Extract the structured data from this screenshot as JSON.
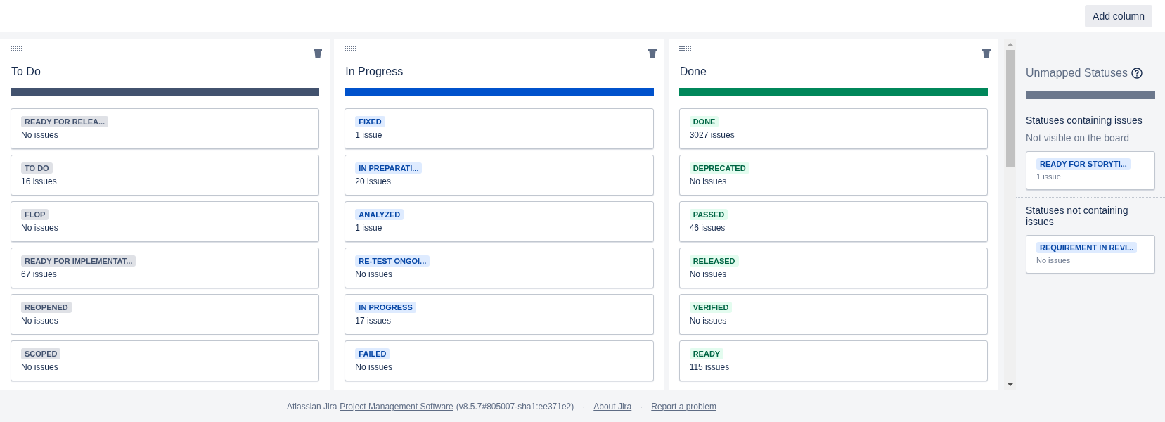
{
  "toolbar": {
    "add_column_button": "Add column"
  },
  "columns": [
    {
      "title": "To Do",
      "color": "#42526e",
      "kind": "todo",
      "statuses": [
        {
          "name": "READY FOR RELEA...",
          "count": "No issues"
        },
        {
          "name": "TO DO",
          "count": "16 issues"
        },
        {
          "name": "FLOP",
          "count": "No issues"
        },
        {
          "name": "READY FOR IMPLEMENTAT...",
          "count": "67 issues"
        },
        {
          "name": "REOPENED",
          "count": "No issues"
        },
        {
          "name": "SCOPED",
          "count": "No issues"
        }
      ]
    },
    {
      "title": "In Progress",
      "color": "#0052cc",
      "kind": "inprogress",
      "statuses": [
        {
          "name": "FIXED",
          "count": "1 issue"
        },
        {
          "name": "IN PREPARATI...",
          "count": "20 issues"
        },
        {
          "name": "ANALYZED",
          "count": "1 issue"
        },
        {
          "name": "RE-TEST ONGOI...",
          "count": "No issues"
        },
        {
          "name": "IN PROGRESS",
          "count": "17 issues"
        },
        {
          "name": "FAILED",
          "count": "No issues"
        }
      ]
    },
    {
      "title": "Done",
      "color": "#00875a",
      "kind": "done",
      "statuses": [
        {
          "name": "DONE",
          "count": "3027 issues"
        },
        {
          "name": "DEPRECATED",
          "count": "No issues"
        },
        {
          "name": "PASSED",
          "count": "46 issues"
        },
        {
          "name": "RELEASED",
          "count": "No issues"
        },
        {
          "name": "VERIFIED",
          "count": "No issues"
        },
        {
          "name": "READY",
          "count": "115 issues"
        }
      ]
    }
  ],
  "unmapped": {
    "title": "Unmapped Statuses",
    "color": "#6b778c",
    "sections": [
      {
        "heading": "Statuses containing issues",
        "subheading": "Not visible on the board",
        "statuses": [
          {
            "name": "READY FOR STORYTI...",
            "count": "1 issue",
            "kind": "inprogress"
          }
        ]
      },
      {
        "heading": "Statuses not containing issues",
        "statuses": [
          {
            "name": "REQUIREMENT IN REVI...",
            "count": "No issues",
            "kind": "inprogress"
          }
        ]
      }
    ]
  },
  "footer": {
    "prefix": "Atlassian Jira",
    "product_link": "Project Management Software",
    "version": "(v8.5.7#805007-sha1:ee371e2)",
    "separator_1": "·",
    "about_link": "About Jira",
    "separator_2": "·",
    "report_link": "Report a problem"
  }
}
